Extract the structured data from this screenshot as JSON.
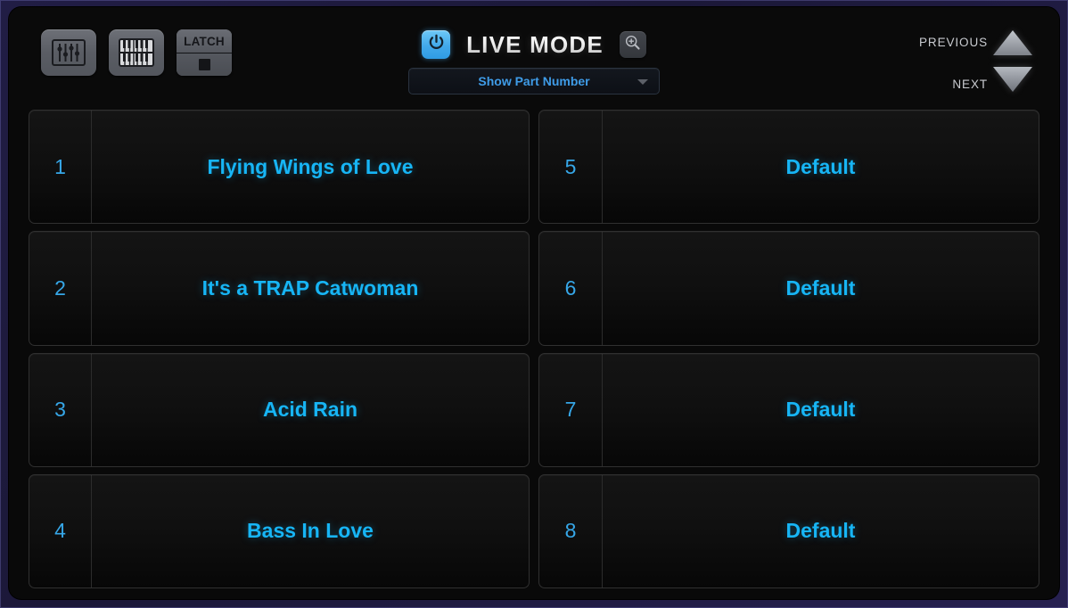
{
  "header": {
    "title": "LIVE MODE",
    "power_icon": "power-icon",
    "zoom_icon": "magnifier-plus-icon",
    "mixer_icon": "mixer-faders-icon",
    "keyboard_icon": "piano-keyboard-icon",
    "latch": {
      "label": "LATCH",
      "led_state": "off"
    },
    "dropdown": {
      "selected": "Show Part Number",
      "arrow_icon": "chevron-down-icon",
      "options": [
        "Show Part Number"
      ]
    },
    "nav": {
      "previous_label": "PREVIOUS",
      "next_label": "NEXT",
      "up_icon": "triangle-up-icon",
      "down_icon": "triangle-down-icon"
    }
  },
  "colors": {
    "accent_cyan": "#17b5f5",
    "number_blue": "#36a7e8",
    "dropdown_text": "#3f9ce8",
    "power_blue": "#42a9ea",
    "frame_navy": "#211d45",
    "panel_black": "#090909",
    "card_border": "#303030"
  },
  "slots": [
    {
      "number": "1",
      "title": "Flying Wings of Love"
    },
    {
      "number": "5",
      "title": "Default"
    },
    {
      "number": "2",
      "title": "It's a TRAP Catwoman"
    },
    {
      "number": "6",
      "title": "Default"
    },
    {
      "number": "3",
      "title": "Acid Rain"
    },
    {
      "number": "7",
      "title": "Default"
    },
    {
      "number": "4",
      "title": "Bass In Love"
    },
    {
      "number": "8",
      "title": "Default"
    }
  ]
}
